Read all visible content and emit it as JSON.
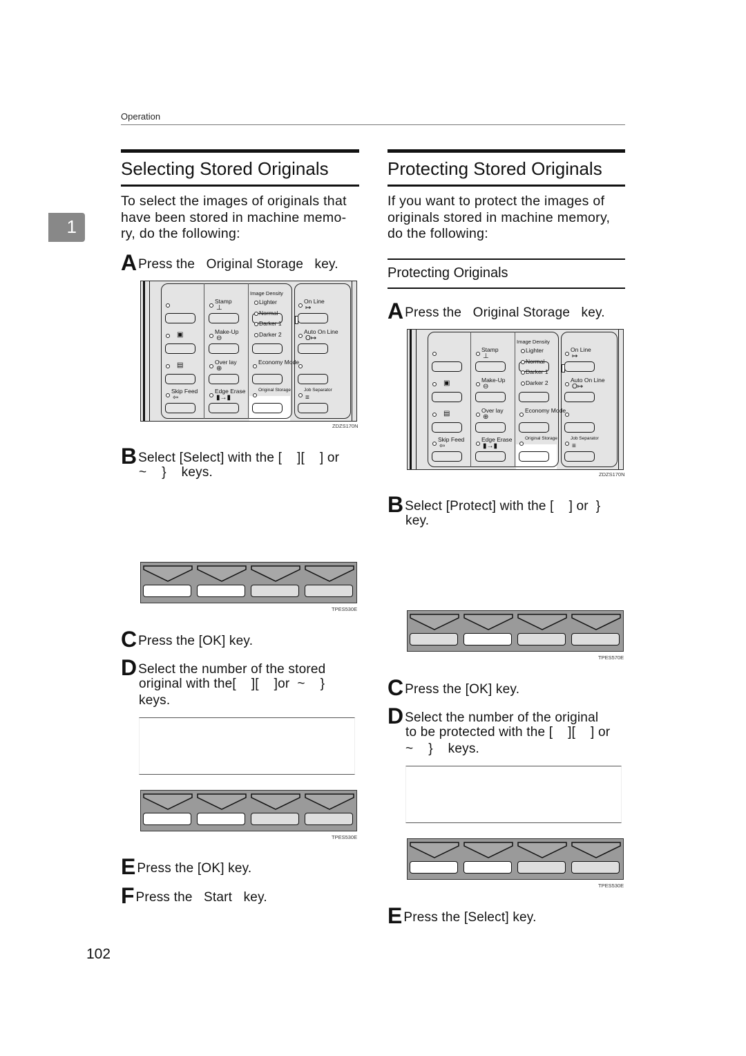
{
  "header": {
    "section": "Operation"
  },
  "chapter_badge": "1",
  "page_number": "102",
  "left": {
    "title": "Selecting Stored Originals",
    "intro": [
      "To select the images of originals that",
      "have been stored in machine memo-",
      "ry, do the following:"
    ],
    "steps": {
      "A": {
        "letter": "A",
        "lines": [
          "Press the   Original Storage   key."
        ]
      },
      "B": {
        "letter": "B",
        "lines": [
          "Select [Select] with the [    ][    ] or",
          "~    }    keys."
        ]
      },
      "C": {
        "letter": "C",
        "lines": [
          "Press the [OK] key."
        ]
      },
      "D": {
        "letter": "D",
        "lines": [
          "Select the number of the stored",
          "original with the[    ][    ]or  ~    }",
          "keys."
        ]
      },
      "E": {
        "letter": "E",
        "lines": [
          "Press the [OK] key."
        ]
      },
      "F": {
        "letter": "F",
        "lines": [
          "Press the   Start   key."
        ]
      }
    },
    "figure_panel_caption": "ZDZS170N",
    "figure_strip1_caption": "TPES530E",
    "figure_strip2_caption": "TPES530E"
  },
  "right": {
    "title": "Protecting Stored Originals",
    "intro": [
      "If you want to protect the images of",
      "originals stored in machine memory,",
      "do the following:"
    ],
    "subheading": "Protecting Originals",
    "steps": {
      "A": {
        "letter": "A",
        "lines": [
          "Press the   Original Storage   key."
        ]
      },
      "B": {
        "letter": "B",
        "lines": [
          "Select [Protect] with the [    ] or  }",
          "key."
        ]
      },
      "C": {
        "letter": "C",
        "lines": [
          "Press the [OK] key."
        ]
      },
      "D": {
        "letter": "D",
        "lines": [
          "Select the number of the original",
          "to be protected with the [    ][    ] or",
          "~    }    keys."
        ]
      },
      "E": {
        "letter": "E",
        "lines": [
          "Press the [Select] key."
        ]
      }
    },
    "figure_panel_caption": "ZDZS170N",
    "figure_strip1_caption": "TPES570E",
    "figure_strip2_caption": "TPES530E"
  },
  "control_panel": {
    "image_density_title": "Image Density",
    "density_levels": [
      "Lighter",
      "Normal",
      "Darker 1",
      "Darker 2"
    ],
    "col1": [
      "",
      "",
      "",
      "Skip Feed"
    ],
    "col2": [
      "Stamp",
      "Make-Up",
      "Over lay",
      "Edge Erase"
    ],
    "col3": [
      "",
      "",
      "Economy Mode",
      "Original Storage"
    ],
    "col4": [
      "On Line",
      "Auto On Line",
      "",
      "Job Separator"
    ],
    "highlighted_key": "Original Storage",
    "icons": {
      "col1": [
        "",
        "sort-icon",
        "staple-icon",
        "skip-feed-icon"
      ],
      "col2": [
        "stamp-icon",
        "make-up-icon",
        "overlay-icon",
        "edge-erase-icon"
      ],
      "col4": [
        "online-icon",
        "auto-online-icon",
        "",
        "job-separator-icon"
      ]
    }
  },
  "key_strips": {
    "left_1": [
      "white",
      "white",
      "gray",
      "gray"
    ],
    "left_2": [
      "white",
      "white",
      "gray",
      "gray"
    ],
    "right_1": [
      "gray",
      "white",
      "gray",
      "gray"
    ],
    "right_2": [
      "white",
      "white",
      "gray",
      "gray"
    ]
  },
  "colors": {
    "strip_bg": "#9a9a9a",
    "key_white": "#ffffff",
    "key_gray": "#dedede",
    "badge": "#888888"
  }
}
